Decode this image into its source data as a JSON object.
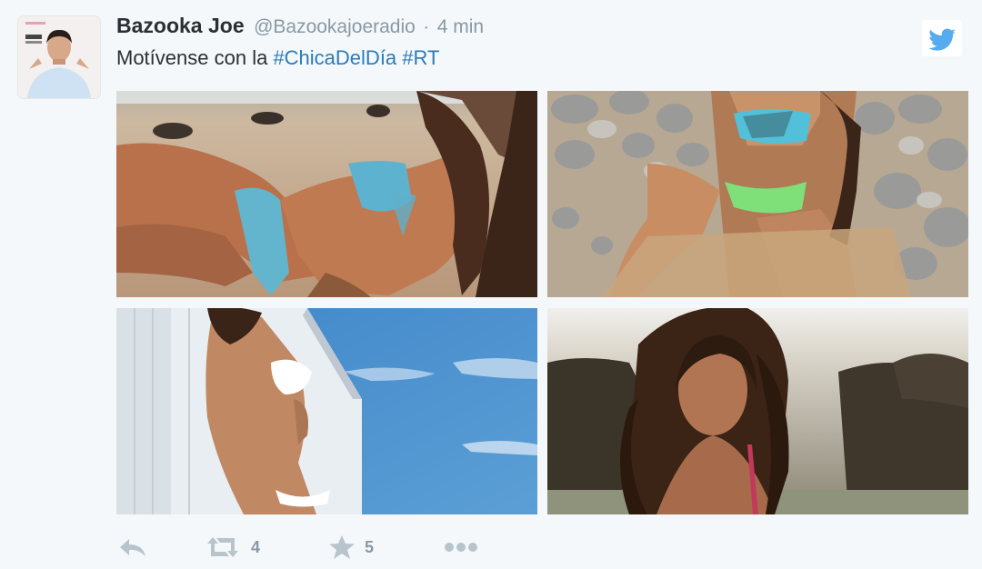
{
  "tweet": {
    "author_name": "Bazooka Joe",
    "handle": "@Bazookajoeradio",
    "separator": "·",
    "time": "4 min",
    "text_prefix": "Motívense con la ",
    "hashtags": [
      "#ChicaDelDía",
      "#RT"
    ]
  },
  "actions": {
    "retweet_count": "4",
    "favorite_count": "5"
  },
  "icons": {
    "reply": "reply-icon",
    "retweet": "retweet-icon",
    "favorite": "star-icon",
    "more": "more-icon",
    "twitter": "twitter-bird-icon"
  },
  "colors": {
    "name": "#292f33",
    "muted": "#8899a6",
    "link": "#2b7bb9",
    "twitter_blue": "#55acee",
    "background": "#f5f8fa"
  }
}
